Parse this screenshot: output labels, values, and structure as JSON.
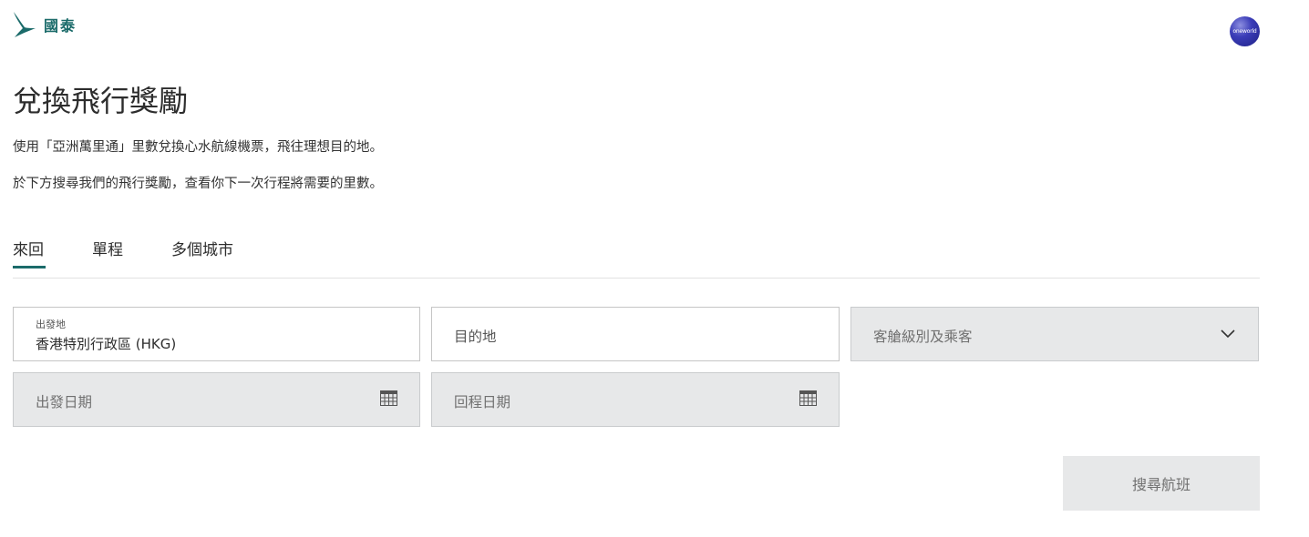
{
  "header": {
    "brand": "國泰",
    "alliance_badge": "oneworld"
  },
  "page": {
    "title": "兌換飛行獎勵",
    "desc1": "使用「亞洲萬里通」里數兌換心水航線機票，飛往理想目的地。",
    "desc2": "於下方搜尋我們的飛行獎勵，查看你下一次行程將需要的里數。"
  },
  "tabs": [
    {
      "label": "來回",
      "active": true
    },
    {
      "label": "單程",
      "active": false
    },
    {
      "label": "多個城市",
      "active": false
    }
  ],
  "form": {
    "origin_label": "出發地",
    "origin_value": "香港特別行政區 (HKG)",
    "destination_placeholder": "目的地",
    "cabin_placeholder": "客艙級別及乘客",
    "depart_date_placeholder": "出發日期",
    "return_date_placeholder": "回程日期",
    "search_label": "搜尋航班"
  },
  "icons": {
    "brand_logo": "brushwing-logo-icon",
    "cabin_dropdown": "chevron-down-icon",
    "date_picker": "calendar-icon"
  },
  "colors": {
    "brand": "#1b6b6a",
    "disabled_bg": "#e7e8e9",
    "text": "#2d2d2d"
  }
}
